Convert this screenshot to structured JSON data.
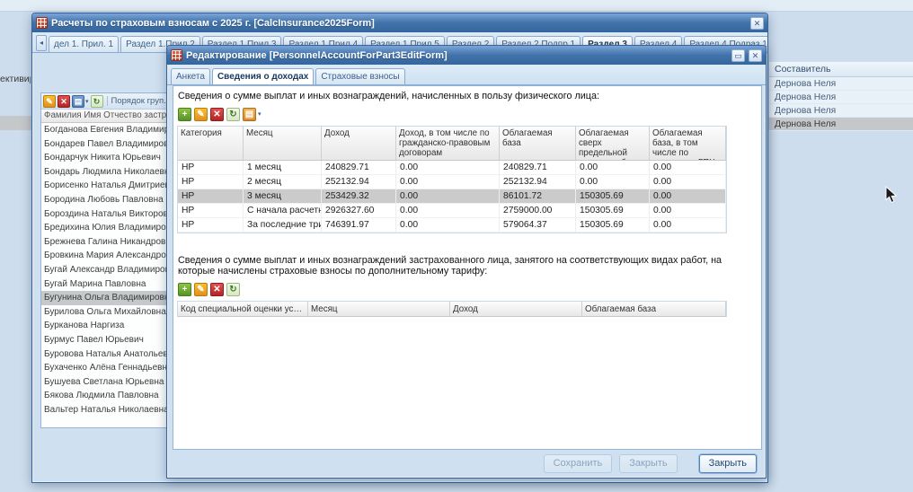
{
  "background": {
    "left_fragment": "ективиров",
    "right_grid": {
      "header": "Составитель",
      "rows": [
        "Дернова Неля",
        "Дернова Неля",
        "Дернова Неля",
        "Дернова Неля"
      ],
      "selected_index": 3
    }
  },
  "icons": {
    "close": "✕",
    "restore": "▭",
    "scroll_left": "◂",
    "scroll_right": "»",
    "add": "+",
    "edit": "✎",
    "delete": "✕",
    "refresh": "↻",
    "export": "▤",
    "print": "▤",
    "dropdown": "▾"
  },
  "main_window": {
    "title": "Расчеты по страховым взносам с 2025 г. [CalcInsurance2025Form]",
    "tabs": [
      {
        "label": "дел 1. Прил. 1",
        "active": false
      },
      {
        "label": "Раздел 1.Прил.2",
        "active": false
      },
      {
        "label": "Раздел 1 Прил.3",
        "active": false
      },
      {
        "label": "Раздел 1 Прил.4",
        "active": false
      },
      {
        "label": "Раздел 1 Прил.5",
        "active": false
      },
      {
        "label": "Раздел 2",
        "active": false
      },
      {
        "label": "Раздел 2 Подпр.1",
        "active": false
      },
      {
        "label": "Раздел 3",
        "active": true
      },
      {
        "label": "Раздел 4",
        "active": false
      },
      {
        "label": "Раздел 4 Подраз.1",
        "active": false
      }
    ],
    "left_grid": {
      "toolbar_label": "Порядок груп...",
      "column_header": "Фамилия Имя Отчество застрахованного",
      "selected_index": 12,
      "rows": [
        "Богданова Евгения Владимировна",
        "Бондарев Павел Владимирович",
        "Бондарчук Никита Юрьевич",
        "Бондарь Людмила Николаевна",
        "Борисенко Наталья Дмитриевна",
        "Бородина Любовь Павловна",
        "Бороздина Наталья Викторовна",
        "Бредихина Юлия Владимировна",
        "Брежнева Галина Никандровна",
        "Бровкина Мария Александровна",
        "Бугай Александр Владимирович",
        "Бугай Марина Павловна",
        "Бугунина Ольга Владимировна",
        "Бурилова Ольга Михайловна",
        "Бурканова Наргиза",
        "Бурмус Павел Юрьевич",
        "Буровова Наталья Анатольевна",
        "Бухаченко Алёна Геннадьевна",
        "Бушуева Светлана Юрьевна",
        "Бякова Людмила Павловна",
        "Вальтер Наталья Николаевна"
      ]
    }
  },
  "modal": {
    "title": "Редактирование [PersonnelAccountForPart3EditForm]",
    "tabs": [
      {
        "label": "Анкета",
        "active": false
      },
      {
        "label": "Сведения о доходах",
        "active": true
      },
      {
        "label": "Страховые взносы",
        "active": false
      }
    ],
    "section1": {
      "label": "Сведения о сумме выплат и иных вознаграждений, начисленных в пользу физического лица:",
      "columns": [
        "Категория",
        "Месяц",
        "Доход",
        "Доход, в том числе по гражданско-правовым договорам",
        "Облагаемая база",
        "Облагаемая сверх предельной величины базы",
        "Облагаемая база, в том числе по договорам ГПХ"
      ],
      "selected_index": 2,
      "rows": [
        [
          "НР",
          "1 месяц",
          "240829.71",
          "0.00",
          "240829.71",
          "0.00",
          "0.00"
        ],
        [
          "НР",
          "2 месяц",
          "252132.94",
          "0.00",
          "252132.94",
          "0.00",
          "0.00"
        ],
        [
          "НР",
          "3 месяц",
          "253429.32",
          "0.00",
          "86101.72",
          "150305.69",
          "0.00"
        ],
        [
          "НР",
          "С начала расчетн...",
          "2926327.60",
          "0.00",
          "2759000.00",
          "150305.69",
          "0.00"
        ],
        [
          "НР",
          "За последние три...",
          "746391.97",
          "0.00",
          "579064.37",
          "150305.69",
          "0.00"
        ]
      ]
    },
    "section2": {
      "label": "Сведения о сумме выплат и иных вознаграждений застрахованного лица, занятого на соответствующих видах работ, на которые начислены страховые взносы по дополнительному тарифу:",
      "columns": [
        "Код специальной оценки условий т...",
        "Месяц",
        "Доход",
        "Облагаемая база"
      ],
      "rows": []
    },
    "buttons": [
      {
        "label": "Сохранить",
        "enabled": false
      },
      {
        "label": "Закрыть",
        "enabled": false
      },
      {
        "label": "Закрыть",
        "enabled": true
      }
    ]
  }
}
